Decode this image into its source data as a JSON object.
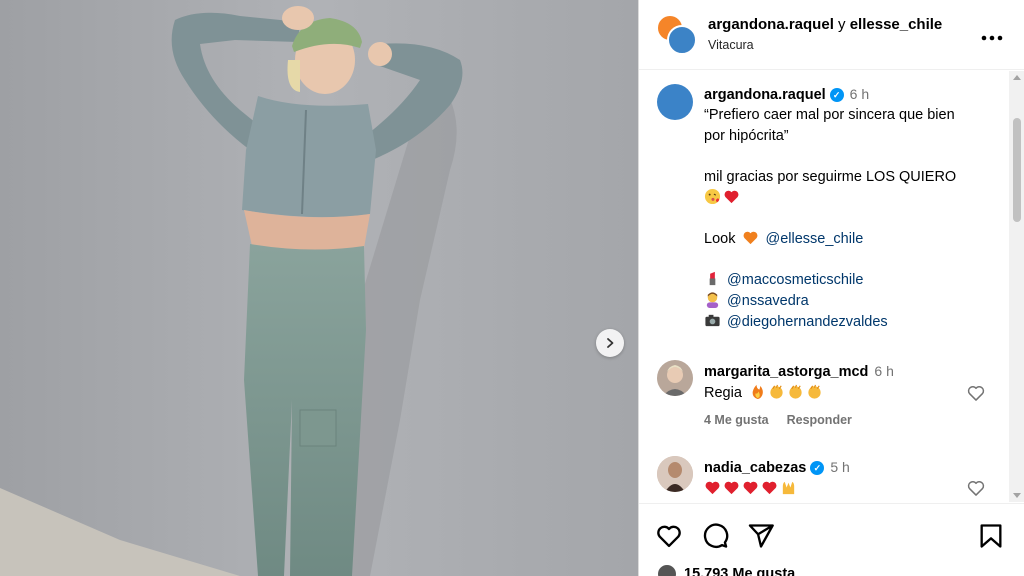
{
  "post": {
    "header": {
      "owner": "argandona.raquel",
      "joiner": "y",
      "collaborator": "ellesse_chile",
      "location": "Vitacura"
    },
    "caption": {
      "username": "argandona.raquel",
      "time": "6 h",
      "quote_line1": "“Prefiero caer mal por sincera que bien",
      "quote_line2": "por hipócrita”",
      "thanks": "mil gracias por seguirme LOS QUIERO",
      "look_label": "Look",
      "mention_look": "@ellesse_chile",
      "mention_makeup": "@maccosmeticschile",
      "mention_hair": "@nssavedra",
      "mention_photo": "@diegohernandezvaldes"
    },
    "comments": [
      {
        "username": "margarita_astorga_mcd",
        "time": "6 h",
        "text": "Regia",
        "likes": "4 Me gusta",
        "reply": "Responder"
      },
      {
        "username": "nadia_cabezas",
        "time": "5 h"
      }
    ],
    "likes_count": "15.793 Me gusta"
  },
  "colors": {
    "link": "#00376b",
    "verified": "#0095f6",
    "muted": "#737373",
    "wall": "#a9abaf",
    "outfit": "#7f9993"
  },
  "icons": [
    "more-icon",
    "verified-icon",
    "heart-icon",
    "comment-icon",
    "share-icon",
    "save-icon",
    "chevron-right-icon"
  ]
}
